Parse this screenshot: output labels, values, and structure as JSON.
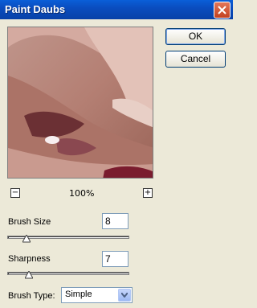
{
  "window": {
    "title": "Paint Daubs"
  },
  "buttons": {
    "ok": "OK",
    "cancel": "Cancel"
  },
  "zoom": {
    "out": "−",
    "level": "100%",
    "in": "+"
  },
  "brush_size": {
    "label": "Brush Size",
    "value": "8",
    "slider_fraction": 0.16
  },
  "sharpness": {
    "label": "Sharpness",
    "value": "7",
    "slider_fraction": 0.18
  },
  "brush_type": {
    "label": "Brush Type:",
    "value": "Simple"
  },
  "colors": {
    "titlebar": "#0a4dbf",
    "close": "#d0502d",
    "dialog": "#ece9d8",
    "input_border": "#7f9db9"
  }
}
